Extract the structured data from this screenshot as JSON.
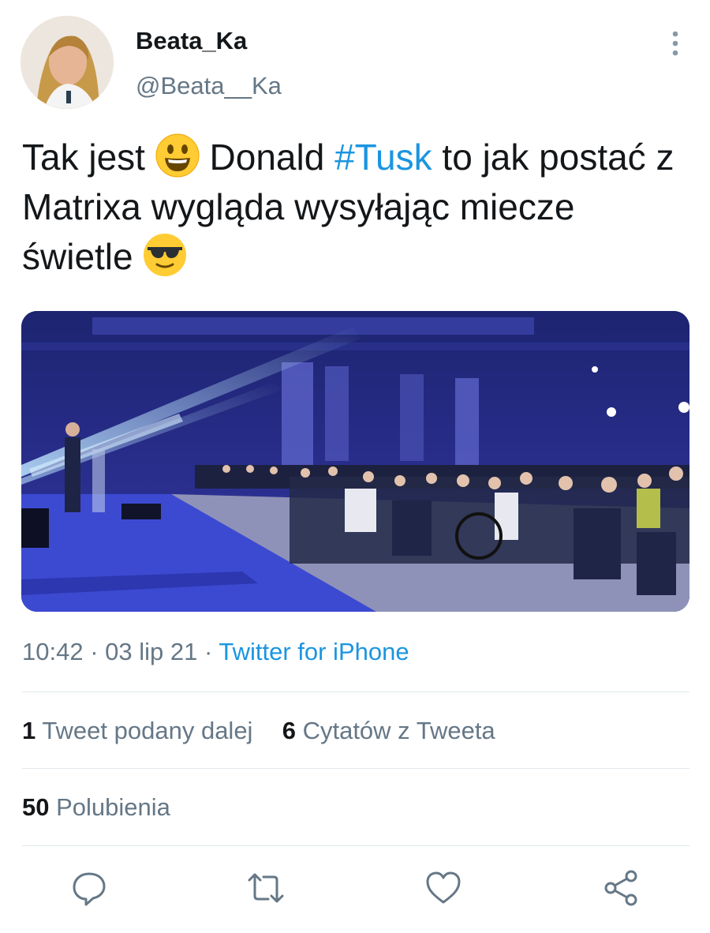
{
  "author": {
    "display_name": "Beata_Ka",
    "handle": "@Beata__Ka",
    "avatar_icon": "user-avatar-photo"
  },
  "tweet": {
    "text_part1": "Tak jest ",
    "emoji1": "smiling-face-icon",
    "text_part2": " Donald ",
    "hashtag": "#Tusk",
    "text_part3": " to jak postać z Matrixa wygląda wysyłając miecze świetle  ",
    "emoji2": "sunglasses-face-icon"
  },
  "media": {
    "description_icon": "conference-photo"
  },
  "meta": {
    "time": "10:42",
    "sep1": " · ",
    "date": "03 lip 21",
    "sep2": " · ",
    "source": "Twitter for iPhone"
  },
  "stats": {
    "retweets_count": "1",
    "retweets_label": "Tweet podany dalej",
    "quotes_count": "6",
    "quotes_label": "Cytatów z Tweeta",
    "likes_count": "50",
    "likes_label": "Polubienia"
  },
  "actions": [
    "reply-icon",
    "retweet-icon",
    "like-icon",
    "share-icon"
  ],
  "colors": {
    "link": "#1b95e0",
    "secondary_text": "#657786",
    "divider": "#e1e8ed"
  }
}
